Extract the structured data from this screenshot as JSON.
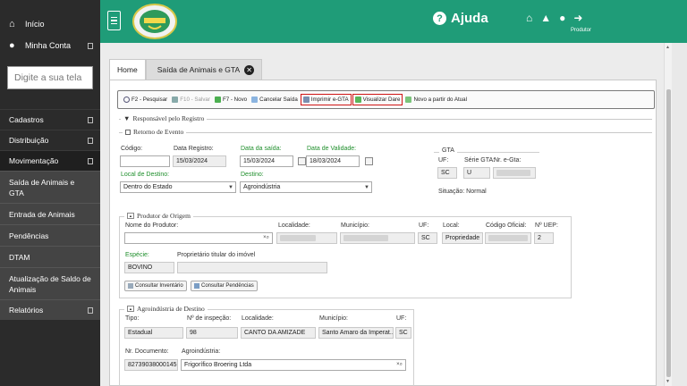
{
  "sidebar": {
    "home_label": "Início",
    "account_label": "Minha Conta",
    "search_placeholder": "Digite a sua tela",
    "items": [
      {
        "label": "Cadastros"
      },
      {
        "label": "Distribuição"
      },
      {
        "label": "Movimentação"
      }
    ],
    "sub_items": [
      {
        "label": "Saída de Animais e GTA"
      },
      {
        "label": "Entrada de Animais"
      },
      {
        "label": "Pendências"
      },
      {
        "label": "DTAM"
      },
      {
        "label": "Atualização de Saldo de Animais"
      }
    ],
    "reports_label": "Relatórios"
  },
  "header": {
    "help_label": "Ajuda",
    "user_role": "Produtor",
    "accent_color": "#1f9c78"
  },
  "tabs": [
    {
      "label": "Home"
    },
    {
      "label": "Saída de Animais e GTA"
    }
  ],
  "toolbar": {
    "search": "F2 - Pesquisar",
    "save": "F10 - Salvar",
    "new": "F7 - Novo",
    "cancel": "Cancelar Saída",
    "print": "Imprimir e-GTA",
    "view": "Visualizar Dare",
    "new_from": "Novo a partir do Atual"
  },
  "form": {
    "responsavel_legend": "Responsável pelo Registro",
    "retorno_legend": "Retorno de Evento",
    "codigo_label": "Código:",
    "codigo_value": "",
    "data_registro_label": "Data Registro:",
    "data_registro_value": "15/03/2024",
    "data_saida_label": "Data da saída:",
    "data_saida_value": "15/03/2024",
    "data_validade_label": "Data de Validade:",
    "data_validade_value": "18/03/2024",
    "local_destino_label": "Local de Destino:",
    "local_destino_value": "Dentro do Estado",
    "destino_label": "Destino:",
    "destino_value": "Agroindústria",
    "gta": {
      "legend": "GTA",
      "uf_label": "UF:",
      "uf_value": "SC",
      "serie_label": "Série GTA:",
      "serie_value": "U",
      "nr_label": "Nr. e-Gta:",
      "situacao_label": "Situação:",
      "situacao_value": "Normal"
    },
    "produtor": {
      "legend": "Produtor de Origem",
      "nome_label": "Nome do Produtor:",
      "localidade_label": "Localidade:",
      "municipio_label": "Município:",
      "uf_label": "UF:",
      "uf_value": "SC",
      "local_label": "Local:",
      "local_value": "Propriedade",
      "codigo_oficial_label": "Código Oficial:",
      "uep_label": "Nº UEP:",
      "uep_value": "2",
      "especie_label": "Espécie:",
      "especie_value": "BOVINO",
      "proprietario_label": "Proprietário titular do imóvel",
      "btn_inventario": "Consultar Inventário",
      "btn_pendencias": "Consultar Pendências"
    },
    "agro": {
      "legend": "Agroindústria de Destino",
      "tipo_label": "Tipo:",
      "tipo_value": "Estadual",
      "inspecao_label": "Nº de inspeção:",
      "inspecao_value": "98",
      "localidade_label": "Localidade:",
      "localidade_value": "CANTO DA AMIZADE",
      "municipio_label": "Município:",
      "municipio_value": "Santo Amaro da Imperat...",
      "uf_label": "UF:",
      "uf_value": "SC",
      "nr_doc_label": "Nr. Documento:",
      "nr_doc_value": "82739038000145",
      "agro_label": "Agroindústria:",
      "agro_value": "Frigorífico Broering Ltda"
    }
  }
}
